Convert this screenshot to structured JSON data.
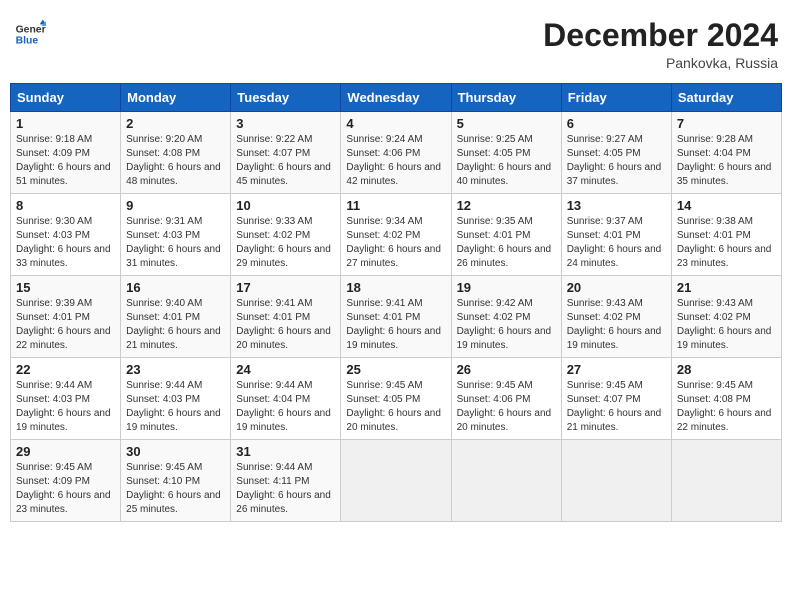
{
  "header": {
    "logo_line1": "General",
    "logo_line2": "Blue",
    "month_title": "December 2024",
    "location": "Pankovka, Russia"
  },
  "weekdays": [
    "Sunday",
    "Monday",
    "Tuesday",
    "Wednesday",
    "Thursday",
    "Friday",
    "Saturday"
  ],
  "weeks": [
    [
      {
        "day": "1",
        "sunrise": "9:18 AM",
        "sunset": "4:09 PM",
        "daylight": "6 hours and 51 minutes."
      },
      {
        "day": "2",
        "sunrise": "9:20 AM",
        "sunset": "4:08 PM",
        "daylight": "6 hours and 48 minutes."
      },
      {
        "day": "3",
        "sunrise": "9:22 AM",
        "sunset": "4:07 PM",
        "daylight": "6 hours and 45 minutes."
      },
      {
        "day": "4",
        "sunrise": "9:24 AM",
        "sunset": "4:06 PM",
        "daylight": "6 hours and 42 minutes."
      },
      {
        "day": "5",
        "sunrise": "9:25 AM",
        "sunset": "4:05 PM",
        "daylight": "6 hours and 40 minutes."
      },
      {
        "day": "6",
        "sunrise": "9:27 AM",
        "sunset": "4:05 PM",
        "daylight": "6 hours and 37 minutes."
      },
      {
        "day": "7",
        "sunrise": "9:28 AM",
        "sunset": "4:04 PM",
        "daylight": "6 hours and 35 minutes."
      }
    ],
    [
      {
        "day": "8",
        "sunrise": "9:30 AM",
        "sunset": "4:03 PM",
        "daylight": "6 hours and 33 minutes."
      },
      {
        "day": "9",
        "sunrise": "9:31 AM",
        "sunset": "4:03 PM",
        "daylight": "6 hours and 31 minutes."
      },
      {
        "day": "10",
        "sunrise": "9:33 AM",
        "sunset": "4:02 PM",
        "daylight": "6 hours and 29 minutes."
      },
      {
        "day": "11",
        "sunrise": "9:34 AM",
        "sunset": "4:02 PM",
        "daylight": "6 hours and 27 minutes."
      },
      {
        "day": "12",
        "sunrise": "9:35 AM",
        "sunset": "4:01 PM",
        "daylight": "6 hours and 26 minutes."
      },
      {
        "day": "13",
        "sunrise": "9:37 AM",
        "sunset": "4:01 PM",
        "daylight": "6 hours and 24 minutes."
      },
      {
        "day": "14",
        "sunrise": "9:38 AM",
        "sunset": "4:01 PM",
        "daylight": "6 hours and 23 minutes."
      }
    ],
    [
      {
        "day": "15",
        "sunrise": "9:39 AM",
        "sunset": "4:01 PM",
        "daylight": "6 hours and 22 minutes."
      },
      {
        "day": "16",
        "sunrise": "9:40 AM",
        "sunset": "4:01 PM",
        "daylight": "6 hours and 21 minutes."
      },
      {
        "day": "17",
        "sunrise": "9:41 AM",
        "sunset": "4:01 PM",
        "daylight": "6 hours and 20 minutes."
      },
      {
        "day": "18",
        "sunrise": "9:41 AM",
        "sunset": "4:01 PM",
        "daylight": "6 hours and 19 minutes."
      },
      {
        "day": "19",
        "sunrise": "9:42 AM",
        "sunset": "4:02 PM",
        "daylight": "6 hours and 19 minutes."
      },
      {
        "day": "20",
        "sunrise": "9:43 AM",
        "sunset": "4:02 PM",
        "daylight": "6 hours and 19 minutes."
      },
      {
        "day": "21",
        "sunrise": "9:43 AM",
        "sunset": "4:02 PM",
        "daylight": "6 hours and 19 minutes."
      }
    ],
    [
      {
        "day": "22",
        "sunrise": "9:44 AM",
        "sunset": "4:03 PM",
        "daylight": "6 hours and 19 minutes."
      },
      {
        "day": "23",
        "sunrise": "9:44 AM",
        "sunset": "4:03 PM",
        "daylight": "6 hours and 19 minutes."
      },
      {
        "day": "24",
        "sunrise": "9:44 AM",
        "sunset": "4:04 PM",
        "daylight": "6 hours and 19 minutes."
      },
      {
        "day": "25",
        "sunrise": "9:45 AM",
        "sunset": "4:05 PM",
        "daylight": "6 hours and 20 minutes."
      },
      {
        "day": "26",
        "sunrise": "9:45 AM",
        "sunset": "4:06 PM",
        "daylight": "6 hours and 20 minutes."
      },
      {
        "day": "27",
        "sunrise": "9:45 AM",
        "sunset": "4:07 PM",
        "daylight": "6 hours and 21 minutes."
      },
      {
        "day": "28",
        "sunrise": "9:45 AM",
        "sunset": "4:08 PM",
        "daylight": "6 hours and 22 minutes."
      }
    ],
    [
      {
        "day": "29",
        "sunrise": "9:45 AM",
        "sunset": "4:09 PM",
        "daylight": "6 hours and 23 minutes."
      },
      {
        "day": "30",
        "sunrise": "9:45 AM",
        "sunset": "4:10 PM",
        "daylight": "6 hours and 25 minutes."
      },
      {
        "day": "31",
        "sunrise": "9:44 AM",
        "sunset": "4:11 PM",
        "daylight": "6 hours and 26 minutes."
      },
      null,
      null,
      null,
      null
    ]
  ],
  "labels": {
    "sunrise": "Sunrise:",
    "sunset": "Sunset:",
    "daylight": "Daylight:"
  }
}
